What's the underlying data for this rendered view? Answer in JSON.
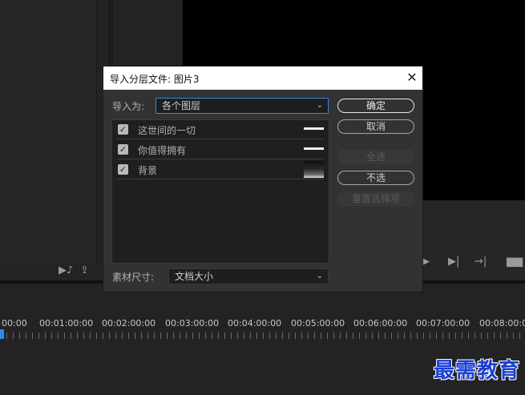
{
  "dialog": {
    "title": "导入分层文件: 图片3",
    "close_glyph": "✕",
    "import_as": {
      "label": "导入为:",
      "value": "各个图层"
    },
    "layers": [
      {
        "label": "这世间的一切",
        "checked": true
      },
      {
        "label": "你值得拥有",
        "checked": true
      },
      {
        "label": "背景",
        "checked": true
      }
    ],
    "footage_size": {
      "label": "素材尺寸:",
      "value": "文档大小"
    },
    "buttons": {
      "ok": "确定",
      "cancel": "取消",
      "select_all": "全选",
      "select_none": "不选",
      "reset": "重置选择项"
    }
  },
  "timeline": {
    "ruler": [
      "00:00",
      "00:01:00:00",
      "00:02:00:00",
      "00:03:00:00",
      "00:04:00:00",
      "00:05:00:00",
      "00:06:00:00",
      "00:07:00:00",
      "00:08:00:00"
    ]
  },
  "watermark": "最需教育",
  "icons": {
    "checkmark": "✓",
    "chevron_down": "⌄"
  },
  "colors": {
    "accent": "#2d8ceb",
    "dialog_bg": "#323232",
    "watermark": "#1a3fd4"
  }
}
